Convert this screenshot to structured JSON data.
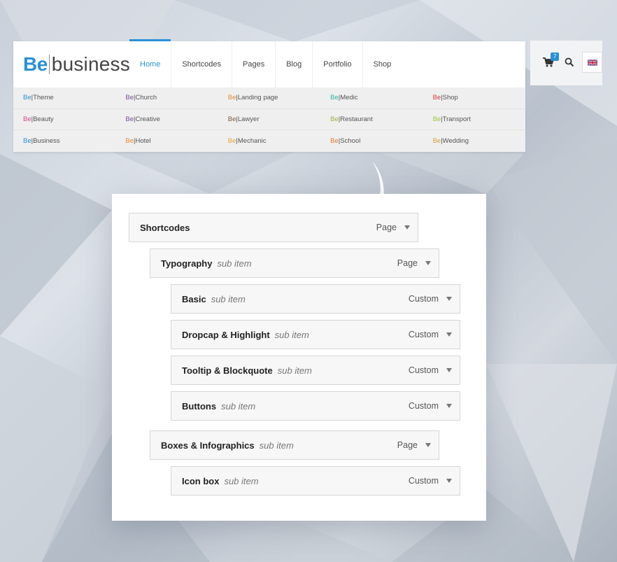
{
  "header": {
    "logo": {
      "be": "Be",
      "name": "business"
    },
    "nav": [
      "Home",
      "Shortcodes",
      "Pages",
      "Blog",
      "Portfolio",
      "Shop"
    ],
    "active_nav": "Home",
    "cart_count": "7"
  },
  "demos": {
    "prefix": "Be",
    "rows": [
      [
        {
          "name": "|Theme",
          "color": "#2991d6"
        },
        {
          "name": "|Church",
          "color": "#7a4a9c"
        },
        {
          "name": "|Landing page",
          "color": "#e68a2e"
        },
        {
          "name": "|Medic",
          "color": "#2bb5a8"
        },
        {
          "name": "|Shop",
          "color": "#d83a3a"
        }
      ],
      [
        {
          "name": "|Beauty",
          "color": "#d6448a"
        },
        {
          "name": "|Creative",
          "color": "#7a4a9c"
        },
        {
          "name": "|Lawyer",
          "color": "#7a5a3a"
        },
        {
          "name": "|Restaurant",
          "color": "#9ab63a"
        },
        {
          "name": "|Transport",
          "color": "#9ac83a"
        }
      ],
      [
        {
          "name": "|Business",
          "color": "#2991d6"
        },
        {
          "name": "|Hotel",
          "color": "#e68a2e"
        },
        {
          "name": "|Mechanic",
          "color": "#e6a02e"
        },
        {
          "name": "|School",
          "color": "#e67a2e"
        },
        {
          "name": "|Wedding",
          "color": "#d6a03a"
        }
      ]
    ]
  },
  "menu": [
    {
      "title": "Shortcodes",
      "sub": "",
      "type": "Page"
    },
    {
      "title": "Typography",
      "sub": "sub item",
      "type": "Page"
    },
    {
      "title": "Basic",
      "sub": "sub item",
      "type": "Custom"
    },
    {
      "title": "Dropcap & Highlight",
      "sub": "sub item",
      "type": "Custom"
    },
    {
      "title": "Tooltip & Blockquote",
      "sub": "sub item",
      "type": "Custom"
    },
    {
      "title": "Buttons",
      "sub": "sub item",
      "type": "Custom"
    },
    {
      "title": "Boxes & Infographics",
      "sub": "sub item",
      "type": "Page"
    },
    {
      "title": "Icon box",
      "sub": "sub item",
      "type": "Custom"
    }
  ]
}
